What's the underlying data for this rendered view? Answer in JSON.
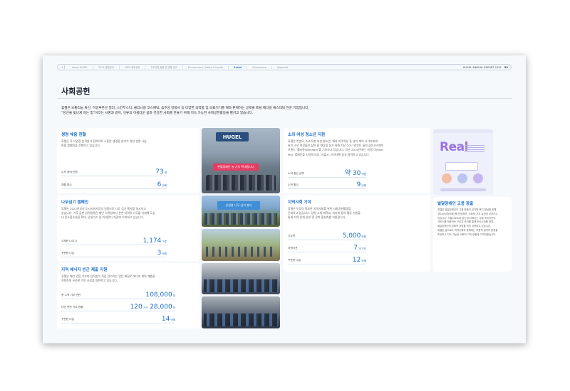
{
  "nav": {
    "items": [
      "About HUGEL",
      "2025 경영성과",
      "2025 재무성과",
      "주요사업 현황 및 경쟁 비교",
      "Environment, Safety & Health",
      "Social",
      "Governance",
      "Appendix"
    ],
    "active_index": 5,
    "report_title": "HUGEL ANNUAL REPORT 2025",
    "page_number": "52"
  },
  "page_title": "사회공헌",
  "intro": {
    "line1": "휴젤은 보툴리눔 톡신, 히알루론산 필러, 스킨부스터, 클리니컬 코스메틱, 음주성 방향사 등 다양한 의약품 및 의료기기를 제조·판매하는 글로벌 토탈 메디컬 에스테틱 전문 기업입니다.",
    "line2": "“당신을 빛나게 하는 힘”이라는 사명과 같이, 인류의 아름다운 삶과 건강한 사회를 만들기 위해 지속 가능한 사회공헌활동을 펼치고 있습니다."
  },
  "cards": {
    "blood": {
      "title": "생명 채움 헌혈",
      "desc": [
        "휴젤은 각 사업장 임직원이 참여하여 소중한 생명을 살리기 위한 생명 나눔",
        "헌혈 캠페인을 진행하고 있습니다."
      ],
      "stats": [
        {
          "label": "누적 참여 인원",
          "value": "73",
          "unit": "명"
        },
        {
          "label": "채혈 횟수",
          "value": "6",
          "unit": "년째"
        }
      ]
    },
    "tree": {
      "title": "나무심기 캠페인",
      "desc": [
        "휴젤은 2023년부터 도시녹화사업의 일환으로 나무 심기 행사를 실시하고",
        "있습니다. 기후 급변 임직원들은 매년 식목일마다 춘천 지역의 나무를 식재해 도심",
        "내 탄소흡수원을 확대, 온실가스 및 미세먼지 저감에 기여하고 있습니다."
      ],
      "stats": [
        {
          "label": "식재한 나무 수",
          "value": "1,174",
          "unit": "그루"
        },
        {
          "label": "꾸준한 나눔",
          "value": "3",
          "unit": "년째"
        }
      ]
    },
    "energy": {
      "title": "지역 에너지 빈곤 제출 지원",
      "desc": [
        "휴젤은 매년 연탄 기부와 임직원이 직접 참가하는 연탄 배달로 에너지 취약 계층을",
        "지원하며 꾸준한 이웃 사랑을 실천하고 있습니다."
      ],
      "stats": [
        {
          "label": "총 누적 기부 연탄",
          "value": "108,000",
          "unit": "장"
        },
        {
          "label": "다면 연탄 기부 현황",
          "value": "120",
          "unit": "가구",
          "value2": "28,000",
          "unit2": "장"
        },
        {
          "label": "꾸준한 나눔",
          "value": "14",
          "unit": "년째"
        }
      ]
    },
    "youth": {
      "title": "소외 여성 청소년 지원",
      "desc": [
        "휴젤은 미혼모, 저소득층 여성 청소년, 해외 미주여성 등 뷰티 케어 사각지대에",
        "놓인 소외 여성들의 삶의 질 향상을 돕기 위해 지난 2017년부터 클리니컬 코스메틱",
        "브랜드 '웰라쥬(Wellage)'를 기부하고 있습니다. 지난 2019년에는 '리얼 미(Real",
        "Me)' 캠페인을 시작해 미혼, 서울시, 기아대책 등과 협력하고 있습니다."
      ],
      "stats": [
        {
          "label": "누적 환산 금액",
          "value": "약 30",
          "unit": "억원"
        },
        {
          "label": "누적 횟수",
          "value": "9",
          "unit": "년째"
        }
      ]
    },
    "regional": {
      "title": "지역사회 기여",
      "desc": [
        "휴젤은 도움이 필요한 지역사회를 위한 사회공헌활동을",
        "전개하고 있습니다. 강원 소재 대학교, 지자체 등의 활동 지원을",
        "통해 지역 인재 양성 및 문화 활성화를 지원합니다."
      ],
      "stats": [
        {
          "label": "기부액",
          "value": "5,000",
          "unit": "만원"
        },
        {
          "label": "지원기관",
          "value": "7",
          "unit": "개 기관"
        },
        {
          "label": "꾸준한 나눔",
          "value": "12",
          "unit": "년째"
        }
      ]
    },
    "disability": {
      "title": "발달장애인 고용 창출",
      "desc": [
        "휴젤은 발달장애인의 고용 창출과 임직원 복지 향상을 위해",
        "'휴Cafe(휴카페)'를 운영하며, 사회적 가치 실천에 앞장서고",
        "있습니다. 서울사무소와 춘천 본사에서는 사회 복지기관의",
        "서비스를 제공하는 근로자 관리를 통해 바리스타를 운영,",
        "발달장애인의 경제적 자립을 적극 지원하고 있습니다.",
        "휴젤은 앞으로도 지역사회와 함께하는 포용적 일자리 환경을",
        "조성하고 지속 가능한 사회적 가치 창출에 기여하겠습니다."
      ]
    }
  },
  "photos": {
    "hugel_sign": "HUGEL",
    "hugel_banner": "헌혈캠페인 늘 기부 확대합니다",
    "tree_banner": "산림청 나무 심기 봉사"
  },
  "poster": {
    "title": "Real"
  },
  "colors": {
    "accent": "#1a6ec8",
    "background": "#f6f9fc"
  }
}
